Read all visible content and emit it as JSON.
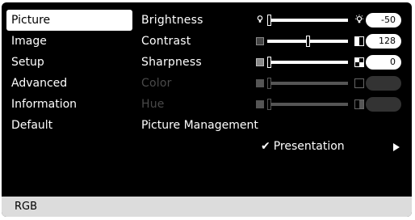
{
  "menu": {
    "items": [
      {
        "label": "Picture",
        "active": true
      },
      {
        "label": "Image",
        "active": false
      },
      {
        "label": "Setup",
        "active": false
      },
      {
        "label": "Advanced",
        "active": false
      },
      {
        "label": "Information",
        "active": false
      },
      {
        "label": "Default",
        "active": false
      }
    ]
  },
  "panel": {
    "rows": [
      {
        "label": "Brightness",
        "value": "-50",
        "level": 0.0,
        "enabled": true,
        "left_icon": "bulb-dim-icon",
        "right_icon": "bulb-bright-icon"
      },
      {
        "label": "Contrast",
        "value": "128",
        "level": 0.5,
        "enabled": true,
        "left_icon": "square-low-contrast-icon",
        "right_icon": "square-high-contrast-icon"
      },
      {
        "label": "Sharpness",
        "value": "0",
        "level": 0.0,
        "enabled": true,
        "left_icon": "square-soft-icon",
        "right_icon": "checker-sharp-icon"
      },
      {
        "label": "Color",
        "value": "",
        "level": 0.0,
        "enabled": false,
        "left_icon": "square-dark-icon",
        "right_icon": "square-light-icon"
      },
      {
        "label": "Hue",
        "value": "",
        "level": 0.0,
        "enabled": false,
        "left_icon": "square-dark-icon",
        "right_icon": "square-half-icon"
      }
    ],
    "picture_management": {
      "label": "Picture Management",
      "selected": "Presentation"
    }
  },
  "status": {
    "source": "RGB"
  },
  "colors": {
    "background": "#000000",
    "selected_bg": "#ffffff",
    "status_bg": "#dcdcdc",
    "disabled_text": "#4a4a4a"
  }
}
